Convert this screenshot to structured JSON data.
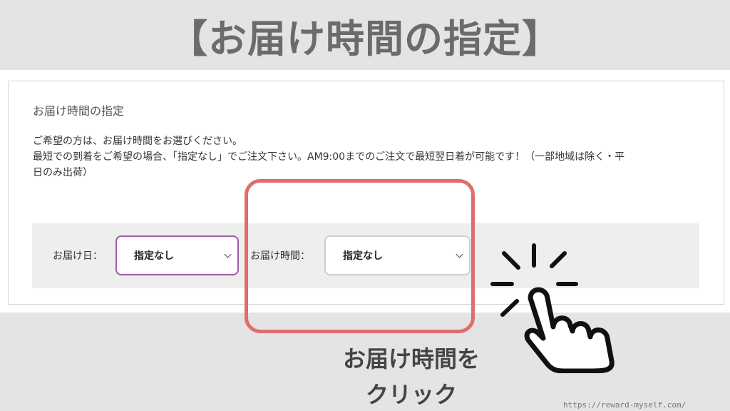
{
  "banner": {
    "title": "【お届け時間の指定】"
  },
  "panel": {
    "heading": "お届け時間の指定",
    "description_lines": [
      "ご希望の方は、お届け時間をお選びください。",
      "最短での到着をご希望の場合、「指定なし」でご注文下さい。AM9:00までのご注文で最短翌日着が可能です！（一部地域は除く・平",
      "日のみ出荷）"
    ]
  },
  "form": {
    "delivery_day": {
      "label": "お届け日：",
      "selected": "指定なし"
    },
    "delivery_time": {
      "label": "お届け時間：",
      "selected": "指定なし"
    }
  },
  "annotation": {
    "caption_lines": [
      "お届け時間を",
      "クリック"
    ],
    "icon": "pointing-hand-click-icon"
  },
  "watermark": "https://reward-myself.com/",
  "colors": {
    "background": "#e4e4e4",
    "banner_text": "#6b6b6b",
    "highlight": "#e06c6c",
    "focused_select_border": "#a05ba8",
    "form_row": "#eeeeee"
  }
}
